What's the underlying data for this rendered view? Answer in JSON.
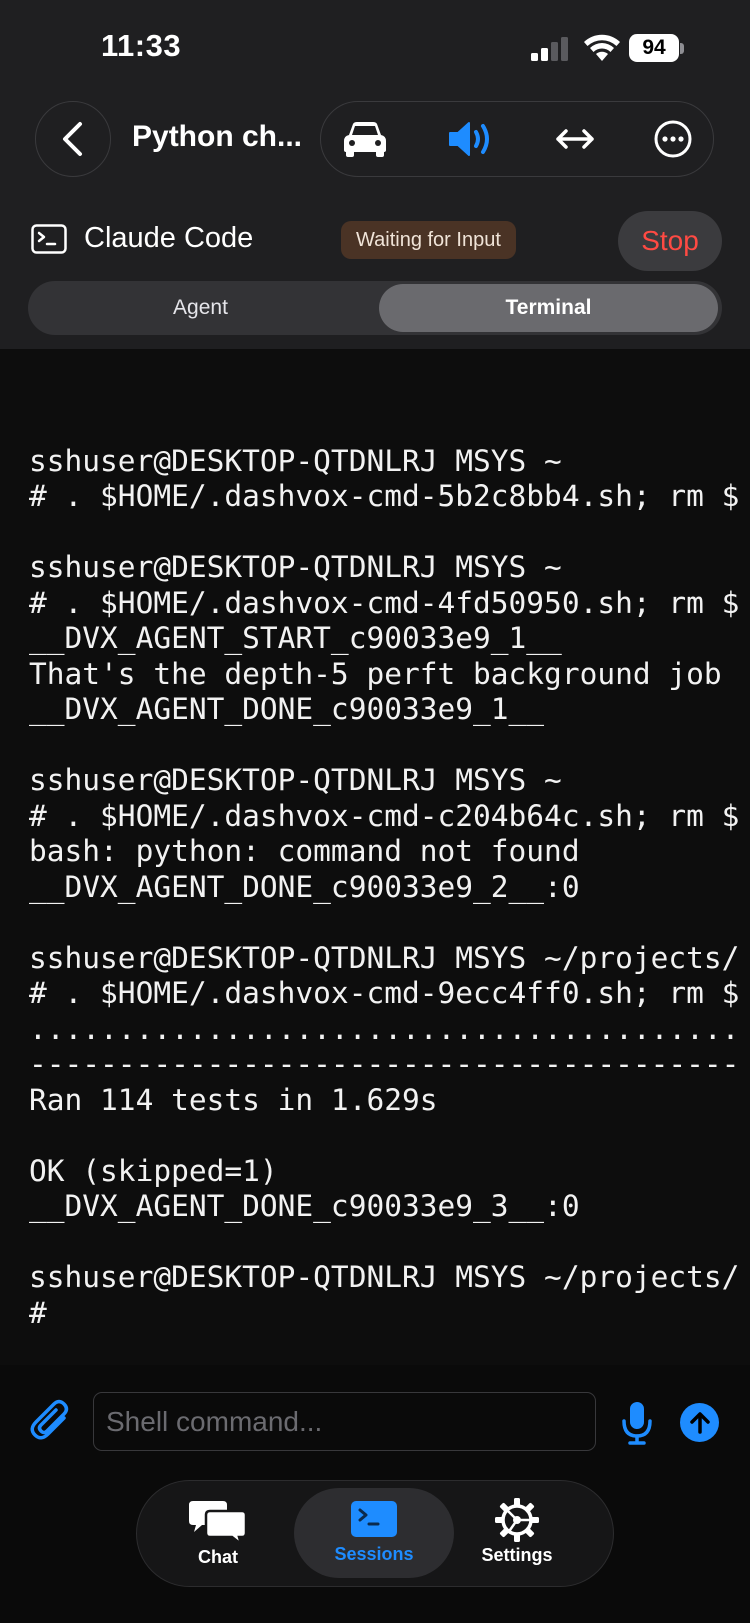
{
  "status_bar": {
    "time": "11:33",
    "battery": "94"
  },
  "header": {
    "title": "Python ch..."
  },
  "session": {
    "name": "Claude Code",
    "status": "Waiting for Input",
    "stop_label": "Stop",
    "tabs": {
      "agent": "Agent",
      "terminal": "Terminal",
      "active": "Terminal"
    }
  },
  "terminal": {
    "lines": [
      "",
      "sshuser@DESKTOP-QTDNLRJ MSYS ~",
      "# . $HOME/.dashvox-cmd-5b2c8bb4.sh; rm $",
      "",
      "sshuser@DESKTOP-QTDNLRJ MSYS ~",
      "# . $HOME/.dashvox-cmd-4fd50950.sh; rm $",
      "__DVX_AGENT_START_c90033e9_1__",
      "That's the depth-5 perft background job",
      "__DVX_AGENT_DONE_c90033e9_1__",
      "",
      "sshuser@DESKTOP-QTDNLRJ MSYS ~",
      "# . $HOME/.dashvox-cmd-c204b64c.sh; rm $",
      "bash: python: command not found",
      "__DVX_AGENT_DONE_c90033e9_2__:0",
      "",
      "sshuser@DESKTOP-QTDNLRJ MSYS ~/projects/",
      "# . $HOME/.dashvox-cmd-9ecc4ff0.sh; rm $",
      "........................................",
      "----------------------------------------",
      "Ran 114 tests in 1.629s",
      "",
      "OK (skipped=1)",
      "__DVX_AGENT_DONE_c90033e9_3__:0",
      "",
      "sshuser@DESKTOP-QTDNLRJ MSYS ~/projects/",
      "#"
    ]
  },
  "input": {
    "placeholder": "Shell command..."
  },
  "tabbar": {
    "items": [
      {
        "label": "Chat",
        "icon": "chat-bubbles-icon",
        "active": false
      },
      {
        "label": "Sessions",
        "icon": "terminal-icon",
        "active": true
      },
      {
        "label": "Settings",
        "icon": "gear-icon",
        "active": false
      }
    ]
  },
  "colors": {
    "accent": "#1e8cff",
    "stop": "#ff4a43",
    "badge_bg": "#4a3325"
  }
}
